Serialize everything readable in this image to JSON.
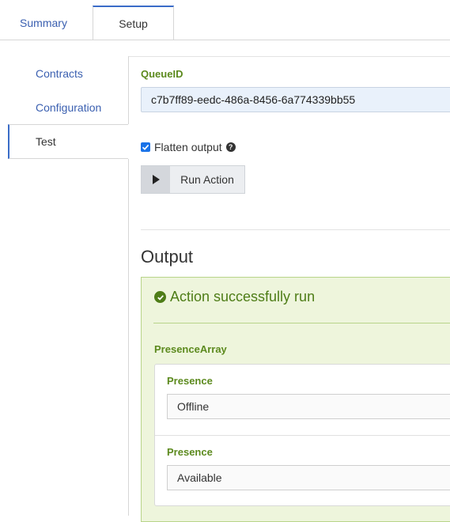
{
  "tabs": {
    "summary": "Summary",
    "setup": "Setup"
  },
  "side_nav": {
    "items": [
      "Contracts",
      "Configuration",
      "Test"
    ],
    "active": "Test"
  },
  "queue": {
    "label": "QueueID",
    "value": "c7b7ff89-eedc-486a-8456-6a774339bb55"
  },
  "flatten": {
    "label": "Flatten output",
    "checked": true
  },
  "run_button": {
    "label": "Run Action"
  },
  "output": {
    "title": "Output",
    "status": "Action successfully run",
    "array_label": "PresenceArray",
    "items": [
      {
        "label": "Presence",
        "value": "Offline"
      },
      {
        "label": "Presence",
        "value": "Available"
      }
    ]
  },
  "colors": {
    "accent": "#3a6cc8",
    "success": "#4e7d17",
    "panel_bg": "#eef5dc"
  }
}
